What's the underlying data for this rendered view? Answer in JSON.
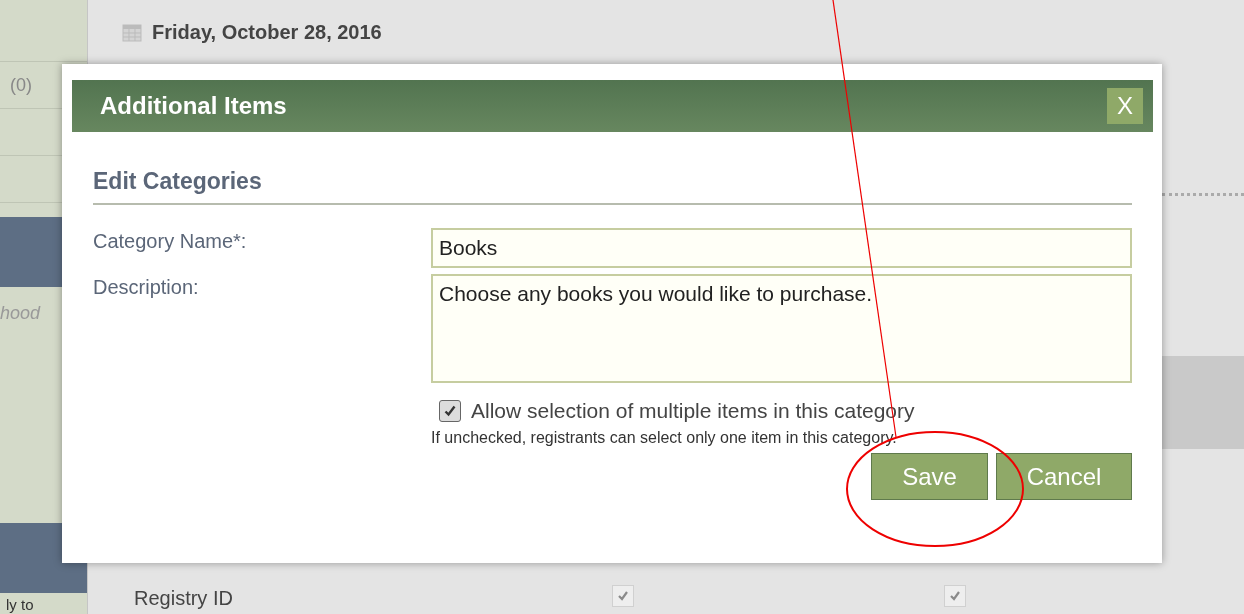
{
  "background": {
    "date": "Friday, October 28, 2016",
    "sidebar": [
      {
        "text": "(0)",
        "kind": "count"
      },
      {
        "text": "hood",
        "kind": "italic"
      },
      {
        "text": "ly to",
        "kind": "plain"
      }
    ],
    "table": {
      "row_label": "Registry ID",
      "checks": [
        {
          "checked": true
        },
        {
          "checked": true
        }
      ]
    }
  },
  "dialog": {
    "title": "Additional Items",
    "close": "X",
    "section": "Edit Categories",
    "fields": [
      {
        "label": "Category Name*:",
        "value": "Books",
        "kind": "input"
      },
      {
        "label": "Description:",
        "value": "Choose any books you would like to purchase.",
        "kind": "textarea"
      }
    ],
    "option": {
      "label": "Allow selection of multiple items in this category",
      "checked": true
    },
    "hint": "If unchecked, registrants can select only one item in this category.",
    "buttons": [
      "Save",
      "Cancel"
    ]
  }
}
